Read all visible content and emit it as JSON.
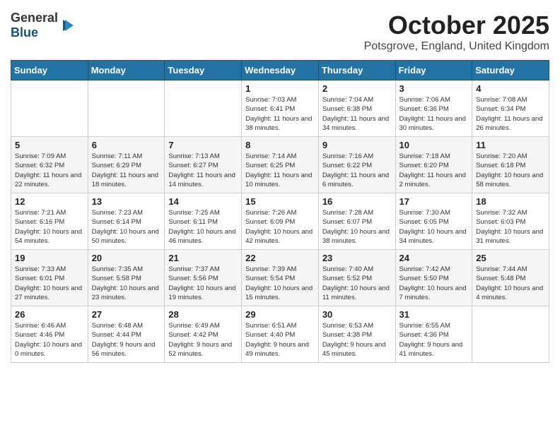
{
  "logo": {
    "line1": "General",
    "line2": "Blue"
  },
  "title": "October 2025",
  "location": "Potsgrove, England, United Kingdom",
  "days_of_week": [
    "Sunday",
    "Monday",
    "Tuesday",
    "Wednesday",
    "Thursday",
    "Friday",
    "Saturday"
  ],
  "weeks": [
    [
      {
        "day": "",
        "sunrise": "",
        "sunset": "",
        "daylight": ""
      },
      {
        "day": "",
        "sunrise": "",
        "sunset": "",
        "daylight": ""
      },
      {
        "day": "",
        "sunrise": "",
        "sunset": "",
        "daylight": ""
      },
      {
        "day": "1",
        "sunrise": "Sunrise: 7:03 AM",
        "sunset": "Sunset: 6:41 PM",
        "daylight": "Daylight: 11 hours and 38 minutes."
      },
      {
        "day": "2",
        "sunrise": "Sunrise: 7:04 AM",
        "sunset": "Sunset: 6:38 PM",
        "daylight": "Daylight: 11 hours and 34 minutes."
      },
      {
        "day": "3",
        "sunrise": "Sunrise: 7:06 AM",
        "sunset": "Sunset: 6:36 PM",
        "daylight": "Daylight: 11 hours and 30 minutes."
      },
      {
        "day": "4",
        "sunrise": "Sunrise: 7:08 AM",
        "sunset": "Sunset: 6:34 PM",
        "daylight": "Daylight: 11 hours and 26 minutes."
      }
    ],
    [
      {
        "day": "5",
        "sunrise": "Sunrise: 7:09 AM",
        "sunset": "Sunset: 6:32 PM",
        "daylight": "Daylight: 11 hours and 22 minutes."
      },
      {
        "day": "6",
        "sunrise": "Sunrise: 7:11 AM",
        "sunset": "Sunset: 6:29 PM",
        "daylight": "Daylight: 11 hours and 18 minutes."
      },
      {
        "day": "7",
        "sunrise": "Sunrise: 7:13 AM",
        "sunset": "Sunset: 6:27 PM",
        "daylight": "Daylight: 11 hours and 14 minutes."
      },
      {
        "day": "8",
        "sunrise": "Sunrise: 7:14 AM",
        "sunset": "Sunset: 6:25 PM",
        "daylight": "Daylight: 11 hours and 10 minutes."
      },
      {
        "day": "9",
        "sunrise": "Sunrise: 7:16 AM",
        "sunset": "Sunset: 6:22 PM",
        "daylight": "Daylight: 11 hours and 6 minutes."
      },
      {
        "day": "10",
        "sunrise": "Sunrise: 7:18 AM",
        "sunset": "Sunset: 6:20 PM",
        "daylight": "Daylight: 11 hours and 2 minutes."
      },
      {
        "day": "11",
        "sunrise": "Sunrise: 7:20 AM",
        "sunset": "Sunset: 6:18 PM",
        "daylight": "Daylight: 10 hours and 58 minutes."
      }
    ],
    [
      {
        "day": "12",
        "sunrise": "Sunrise: 7:21 AM",
        "sunset": "Sunset: 6:16 PM",
        "daylight": "Daylight: 10 hours and 54 minutes."
      },
      {
        "day": "13",
        "sunrise": "Sunrise: 7:23 AM",
        "sunset": "Sunset: 6:14 PM",
        "daylight": "Daylight: 10 hours and 50 minutes."
      },
      {
        "day": "14",
        "sunrise": "Sunrise: 7:25 AM",
        "sunset": "Sunset: 6:11 PM",
        "daylight": "Daylight: 10 hours and 46 minutes."
      },
      {
        "day": "15",
        "sunrise": "Sunrise: 7:26 AM",
        "sunset": "Sunset: 6:09 PM",
        "daylight": "Daylight: 10 hours and 42 minutes."
      },
      {
        "day": "16",
        "sunrise": "Sunrise: 7:28 AM",
        "sunset": "Sunset: 6:07 PM",
        "daylight": "Daylight: 10 hours and 38 minutes."
      },
      {
        "day": "17",
        "sunrise": "Sunrise: 7:30 AM",
        "sunset": "Sunset: 6:05 PM",
        "daylight": "Daylight: 10 hours and 34 minutes."
      },
      {
        "day": "18",
        "sunrise": "Sunrise: 7:32 AM",
        "sunset": "Sunset: 6:03 PM",
        "daylight": "Daylight: 10 hours and 31 minutes."
      }
    ],
    [
      {
        "day": "19",
        "sunrise": "Sunrise: 7:33 AM",
        "sunset": "Sunset: 6:01 PM",
        "daylight": "Daylight: 10 hours and 27 minutes."
      },
      {
        "day": "20",
        "sunrise": "Sunrise: 7:35 AM",
        "sunset": "Sunset: 5:58 PM",
        "daylight": "Daylight: 10 hours and 23 minutes."
      },
      {
        "day": "21",
        "sunrise": "Sunrise: 7:37 AM",
        "sunset": "Sunset: 5:56 PM",
        "daylight": "Daylight: 10 hours and 19 minutes."
      },
      {
        "day": "22",
        "sunrise": "Sunrise: 7:39 AM",
        "sunset": "Sunset: 5:54 PM",
        "daylight": "Daylight: 10 hours and 15 minutes."
      },
      {
        "day": "23",
        "sunrise": "Sunrise: 7:40 AM",
        "sunset": "Sunset: 5:52 PM",
        "daylight": "Daylight: 10 hours and 11 minutes."
      },
      {
        "day": "24",
        "sunrise": "Sunrise: 7:42 AM",
        "sunset": "Sunset: 5:50 PM",
        "daylight": "Daylight: 10 hours and 7 minutes."
      },
      {
        "day": "25",
        "sunrise": "Sunrise: 7:44 AM",
        "sunset": "Sunset: 5:48 PM",
        "daylight": "Daylight: 10 hours and 4 minutes."
      }
    ],
    [
      {
        "day": "26",
        "sunrise": "Sunrise: 6:46 AM",
        "sunset": "Sunset: 4:46 PM",
        "daylight": "Daylight: 10 hours and 0 minutes."
      },
      {
        "day": "27",
        "sunrise": "Sunrise: 6:48 AM",
        "sunset": "Sunset: 4:44 PM",
        "daylight": "Daylight: 9 hours and 56 minutes."
      },
      {
        "day": "28",
        "sunrise": "Sunrise: 6:49 AM",
        "sunset": "Sunset: 4:42 PM",
        "daylight": "Daylight: 9 hours and 52 minutes."
      },
      {
        "day": "29",
        "sunrise": "Sunrise: 6:51 AM",
        "sunset": "Sunset: 4:40 PM",
        "daylight": "Daylight: 9 hours and 49 minutes."
      },
      {
        "day": "30",
        "sunrise": "Sunrise: 6:53 AM",
        "sunset": "Sunset: 4:38 PM",
        "daylight": "Daylight: 9 hours and 45 minutes."
      },
      {
        "day": "31",
        "sunrise": "Sunrise: 6:55 AM",
        "sunset": "Sunset: 4:36 PM",
        "daylight": "Daylight: 9 hours and 41 minutes."
      },
      {
        "day": "",
        "sunrise": "",
        "sunset": "",
        "daylight": ""
      }
    ]
  ]
}
